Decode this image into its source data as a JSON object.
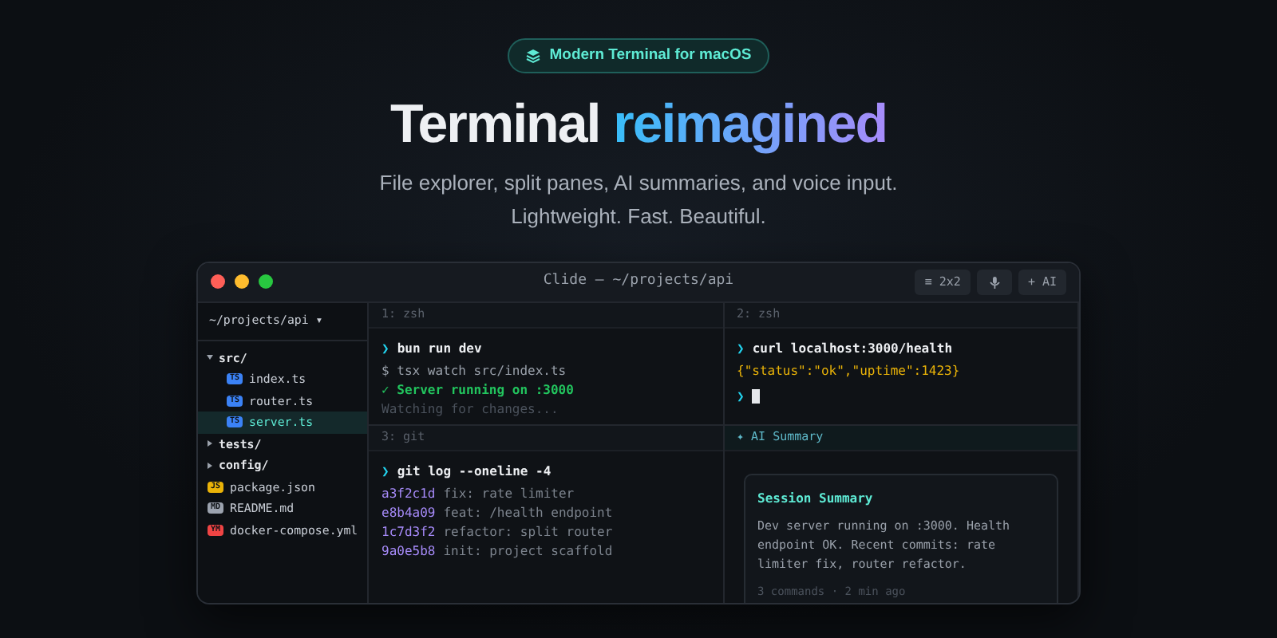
{
  "badge": {
    "text": "Modern Terminal for macOS"
  },
  "headline": {
    "plain": "Terminal",
    "accent": "reimagined"
  },
  "subtitle": [
    "File explorer, split panes, AI summaries, and voice input.",
    "Lightweight. Fast. Beautiful."
  ],
  "window": {
    "title": "Clide — ~/projects/api",
    "toolbar": [
      {
        "kind": "text",
        "label": "≡ 2x2"
      },
      {
        "kind": "mic"
      },
      {
        "kind": "text",
        "label": "+ AI"
      }
    ],
    "sidebar": {
      "header": "~/projects/api ▾",
      "tree": [
        {
          "kind": "folder",
          "name": "src/",
          "expanded": true,
          "selected": false,
          "children": [
            {
              "kind": "file",
              "name": "index.ts",
              "tag": "TS",
              "color": "#3b82f6",
              "selected": false
            },
            {
              "kind": "file",
              "name": "router.ts",
              "tag": "TS",
              "color": "#3b82f6",
              "selected": false
            },
            {
              "kind": "file",
              "name": "server.ts",
              "tag": "TS",
              "color": "#3b82f6",
              "selected": true
            }
          ]
        },
        {
          "kind": "folder",
          "name": "tests/",
          "expanded": false,
          "selected": false
        },
        {
          "kind": "folder",
          "name": "config/",
          "expanded": false,
          "selected": false
        },
        {
          "kind": "file",
          "name": "package.json",
          "tag": "JS",
          "color": "#eab308",
          "selected": false
        },
        {
          "kind": "file",
          "name": "README.md",
          "tag": "MD",
          "color": "#9ca3af",
          "selected": false
        },
        {
          "kind": "file",
          "name": "docker-compose.yml",
          "tag": "YM",
          "color": "#ef4444",
          "selected": false
        }
      ]
    },
    "panes": [
      {
        "kind": "terminal",
        "header": "1: zsh",
        "lines": [
          {
            "kind": "command",
            "prompt": "❯",
            "text": "bun run dev"
          },
          {
            "kind": "output",
            "text": "$ tsx watch src/index.ts"
          },
          {
            "kind": "success",
            "text": "✓ Server running on :3000"
          },
          {
            "kind": "muted",
            "text": "Watching for changes..."
          }
        ]
      },
      {
        "kind": "terminal",
        "header": "2: zsh",
        "lines": [
          {
            "kind": "command",
            "prompt": "❯",
            "text": "curl localhost:3000/health"
          },
          {
            "kind": "json",
            "text": "{\"status\":\"ok\",\"uptime\":1423}"
          },
          {
            "kind": "cursor",
            "prompt": "❯"
          }
        ]
      },
      {
        "kind": "terminal",
        "header": "3: git",
        "lines": [
          {
            "kind": "command",
            "prompt": "❯",
            "text": "git log --oneline -4"
          },
          {
            "kind": "commit",
            "hash": "a3f2c1d",
            "text": "fix: rate limiter"
          },
          {
            "kind": "commit",
            "hash": "e8b4a09",
            "text": "feat: /health endpoint"
          },
          {
            "kind": "commit",
            "hash": "1c7d3f2",
            "text": "refactor: split router"
          },
          {
            "kind": "commit",
            "hash": "9a0e5b8",
            "text": "init: project scaffold"
          }
        ]
      },
      {
        "kind": "summary",
        "header": "✦ AI Summary",
        "card": {
          "title": "Session Summary",
          "body": "Dev server running on :3000. Health endpoint OK. Recent commits: rate limiter fix, router refactor.",
          "meta": "3 commands · 2 min ago"
        }
      }
    ]
  }
}
